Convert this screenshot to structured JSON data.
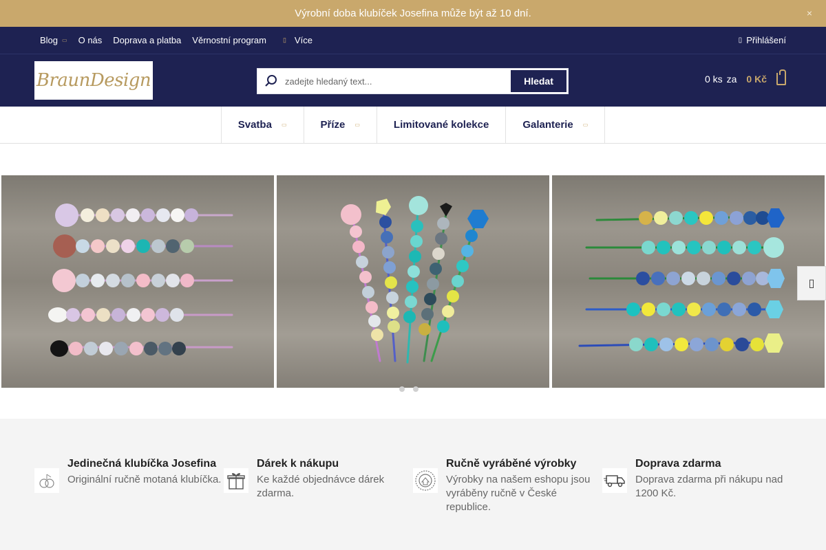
{
  "announcement": {
    "text": "Výrobní doba klubíček Josefina může být až 10 dní.",
    "close_icon": "×"
  },
  "topnav": {
    "items": [
      {
        "label": "Blog",
        "has_caret": true
      },
      {
        "label": "O nás"
      },
      {
        "label": "Doprava a platba"
      },
      {
        "label": "Věrnostní program"
      }
    ],
    "more_label": "Více",
    "login_label": "Přihlášení"
  },
  "header": {
    "logo_text": "BraunDesign",
    "search_placeholder": "zadejte hledaný text...",
    "search_button": "Hledat",
    "cart_count": "0 ks",
    "cart_za": "za",
    "cart_price": "0 Kč"
  },
  "mainmenu": {
    "items": [
      {
        "label": "Svatba",
        "caret": true
      },
      {
        "label": "Příze",
        "caret": true
      },
      {
        "label": "Limitované kolekce",
        "caret": false
      },
      {
        "label": "Galanterie",
        "caret": true
      }
    ]
  },
  "features": [
    {
      "title": "Jedinečná klubíčka Josefina",
      "desc": "Originální ručně motaná klubíčka.",
      "icon": "yarn-balls-icon"
    },
    {
      "title": "Dárek k nákupu",
      "desc": "Ke každé objednávce dárek zdarma.",
      "icon": "gift-icon"
    },
    {
      "title": "Ručně vyráběné výrobky",
      "desc": "Výrobky na našem eshopu jsou vyráběny ručně v České republice.",
      "icon": "handmade-stamp-icon"
    },
    {
      "title": "Doprava zdarma",
      "desc": "Doprava zdarma při nákupu nad 1200 Kč.",
      "icon": "delivery-truck-icon"
    }
  ],
  "colors": {
    "navy": "#1e2252",
    "gold": "#c9a86c"
  }
}
